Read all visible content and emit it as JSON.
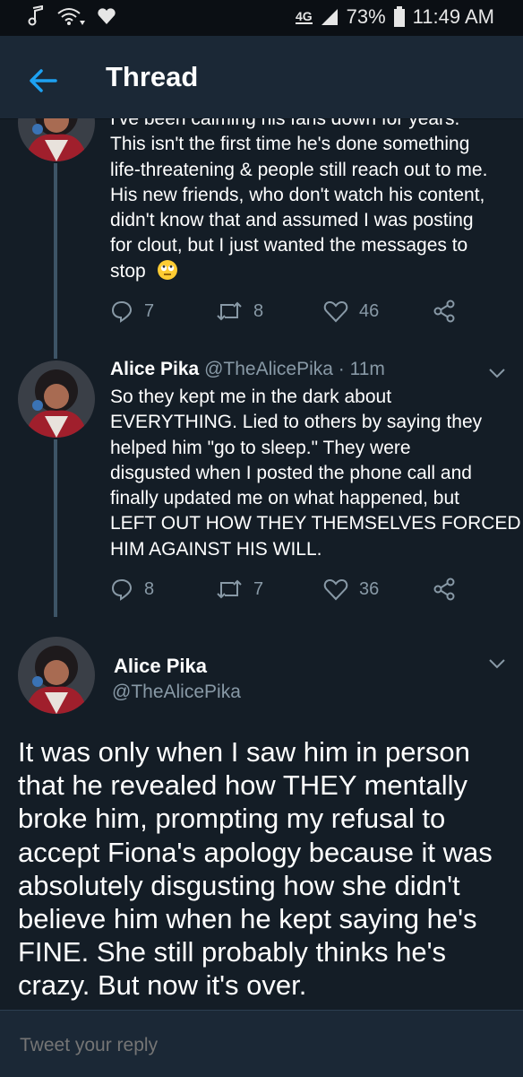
{
  "status_bar": {
    "network": "4G",
    "battery": "73%",
    "time": "11:49 AM"
  },
  "header": {
    "title": "Thread"
  },
  "tweets": [
    {
      "lines": [
        "I've been calming his fans down for years.",
        "This isn't the first time he's done something",
        "life-threatening & people still reach out to me.",
        "His new friends, who don't watch his content,",
        "didn't know that and assumed I was posting",
        "for clout, but I just wanted the messages to",
        "stop"
      ],
      "emoji_icon": "eye-roll-emoji-icon",
      "replies": "7",
      "retweets": "8",
      "likes": "46"
    },
    {
      "name": "Alice Pika",
      "handle": "@TheAlicePika",
      "time": "· 11m",
      "lines": [
        "So they kept me in the dark about",
        "EVERYTHING. Lied to others by saying they",
        "helped him \"go to sleep.\" They were",
        "disgusted when I posted the phone call and",
        "finally updated me on what happened, but",
        "LEFT OUT HOW THEY THEMSELVES FORCED",
        "HIM AGAINST HIS WILL."
      ],
      "replies": "8",
      "retweets": "7",
      "likes": "36"
    }
  ],
  "focused_tweet": {
    "name": "Alice Pika",
    "handle": "@TheAlicePika",
    "lines": [
      "It was only when I saw him in person",
      "that he revealed how THEY mentally",
      "broke him, prompting my refusal to",
      "accept Fiona's apology because it was",
      "absolutely disgusting how she didn't",
      "believe him when he kept saying he's",
      "FINE. She still probably thinks he's",
      "crazy. But now it's over."
    ]
  },
  "reply_bar": {
    "placeholder": "Tweet your reply"
  },
  "colors": {
    "background": "#141d26",
    "header": "#1b2836",
    "accent": "#1da1f2",
    "muted": "#8899a6"
  }
}
